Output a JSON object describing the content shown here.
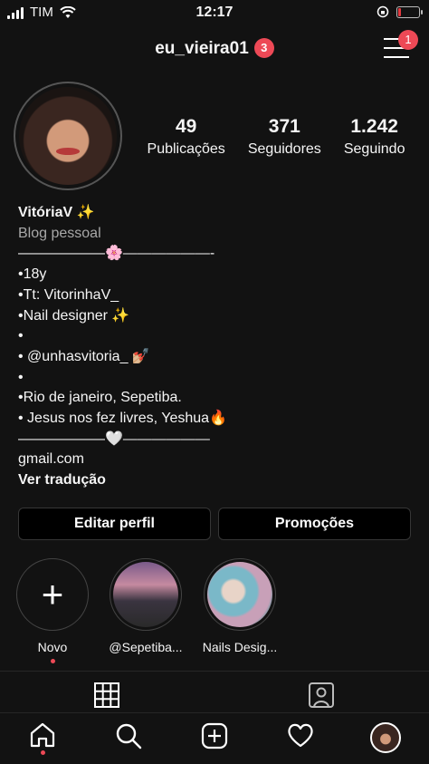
{
  "status_bar": {
    "carrier": "TIM",
    "time": "12:17",
    "battery_level": 0.12,
    "battery_color": "#e5393f"
  },
  "header": {
    "username": "eu_vieira01",
    "notification_count": "3",
    "menu_badge": "1",
    "menu_icon": "hamburger-menu-icon"
  },
  "profile": {
    "stats": [
      {
        "value": "49",
        "label": "Publicações"
      },
      {
        "value": "371",
        "label": "Seguidores"
      },
      {
        "value": "1.242",
        "label": "Seguindo"
      }
    ],
    "name": "VitóriaV ✨",
    "category": "Blog pessoal",
    "bio_lines": [
      "——————🌸——————-",
      "•18y",
      "•Tt: VitorinhaV_",
      "•Nail designer ✨",
      "•",
      "• @unhasvitoria_ 💅🏼",
      "•",
      "•Rio de janeiro, Sepetiba.",
      "• Jesus nos fez livres, Yeshua🔥",
      "——————🤍——————",
      "gmail.com"
    ],
    "see_translation": "Ver tradução"
  },
  "buttons": {
    "edit_profile": "Editar perfil",
    "promotions": "Promoções"
  },
  "highlights": [
    {
      "label": "Novo",
      "icon": "plus-icon"
    },
    {
      "label": "@Sepetiba..."
    },
    {
      "label": "Nails Desig..."
    }
  ],
  "tabs": {
    "grid_icon": "grid-icon",
    "tagged_icon": "tagged-person-icon"
  },
  "bottom_nav": [
    "home-icon",
    "search-icon",
    "new-post-icon",
    "activity-heart-icon",
    "profile-avatar"
  ],
  "colors": {
    "background": "#121212",
    "accent_red": "#ed4956"
  }
}
